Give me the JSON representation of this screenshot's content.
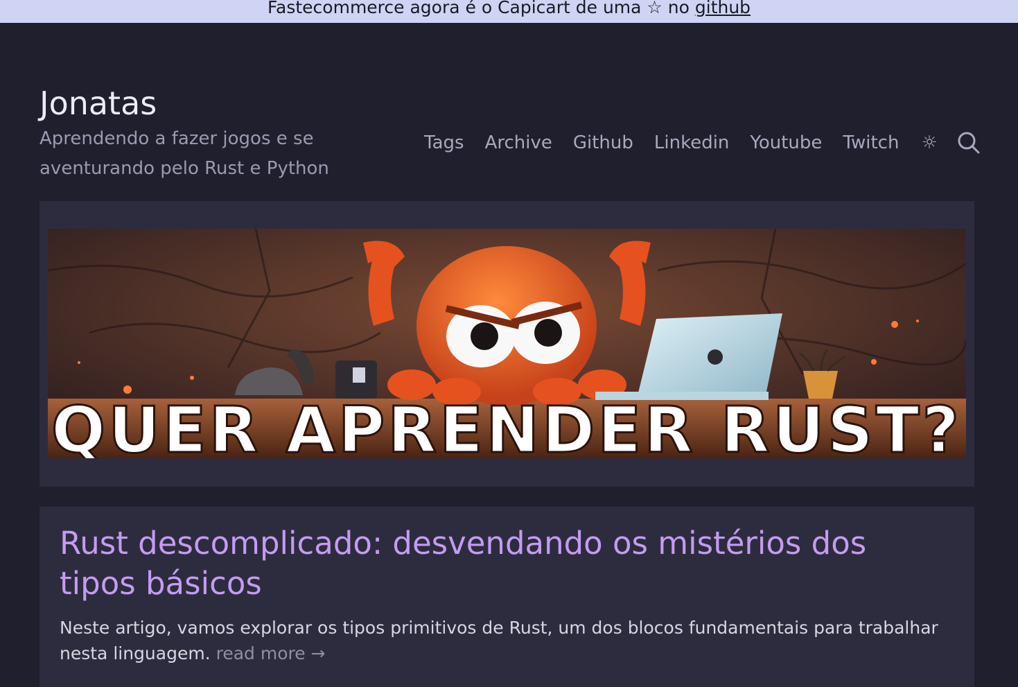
{
  "announcement": {
    "text": "Fastecommerce agora é o Capicart de uma ☆ no",
    "link_label": "github"
  },
  "site": {
    "title": "Jonatas",
    "subtitle": "Aprendendo a fazer jogos e se aventurando pelo Rust e Python"
  },
  "nav": {
    "items": [
      {
        "label": "Tags"
      },
      {
        "label": "Archive"
      },
      {
        "label": "Github"
      },
      {
        "label": "Linkedin"
      },
      {
        "label": "Youtube"
      },
      {
        "label": "Twitch"
      }
    ],
    "theme_icon": "sun-icon",
    "search_icon": "search-icon"
  },
  "hero": {
    "banner_text": "QUER APRENDER RUST?"
  },
  "post": {
    "title": "Rust descomplicado: desvendando os mistérios dos tipos básicos",
    "excerpt": "Neste artigo, vamos explorar os tipos primitivos de Rust, um dos blocos fundamentais para trabalhar nesta linguagem.",
    "read_more": "read more →"
  },
  "colors": {
    "background": "#1f1f2e",
    "card": "#2d2c3f",
    "accent": "#c49cf0",
    "announcement_bg": "#cfd4f4"
  }
}
